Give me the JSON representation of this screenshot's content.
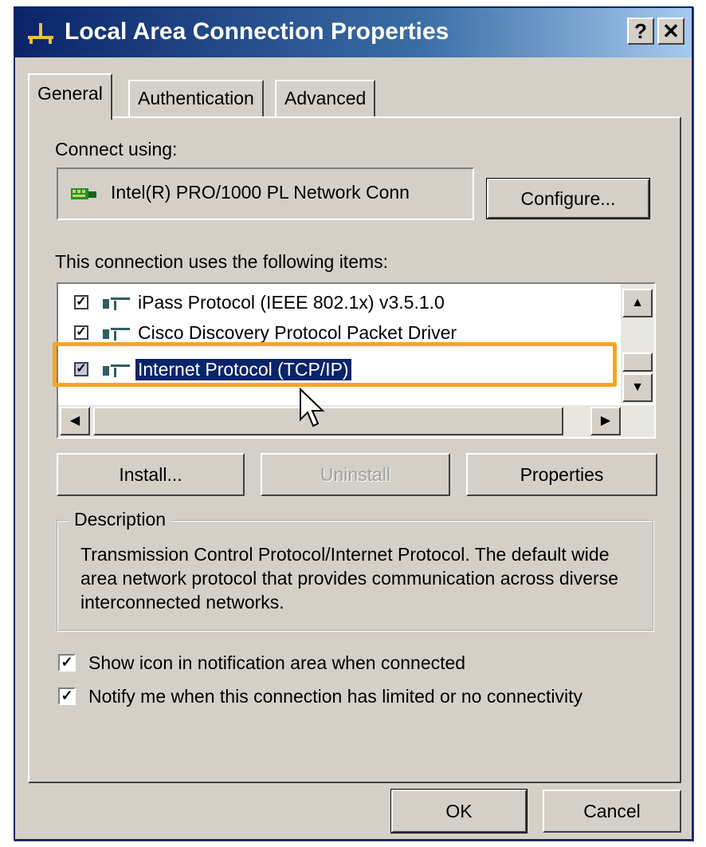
{
  "window": {
    "title": "Local Area Connection Properties",
    "help_button": "?",
    "close_button": "✕"
  },
  "tabs": [
    {
      "label": "General",
      "active": true
    },
    {
      "label": "Authentication",
      "active": false
    },
    {
      "label": "Advanced",
      "active": false
    }
  ],
  "connect": {
    "label": "Connect using:",
    "adapter": "Intel(R) PRO/1000 PL Network Conn",
    "configure_button": "Configure..."
  },
  "items": {
    "label": "This connection uses the following items:",
    "list": [
      {
        "label": "iPass Protocol (IEEE 802.1x) v3.5.1.0",
        "checked": true,
        "selected": false
      },
      {
        "label": "Cisco Discovery Protocol Packet Driver",
        "checked": true,
        "selected": false
      },
      {
        "label": "Internet Protocol (TCP/IP)",
        "checked": true,
        "selected": true
      }
    ]
  },
  "buttons": {
    "install": "Install...",
    "uninstall": "Uninstall",
    "properties": "Properties",
    "ok": "OK",
    "cancel": "Cancel"
  },
  "description": {
    "legend": "Description",
    "text": "Transmission Control Protocol/Internet Protocol. The default wide area network protocol that provides communication across diverse interconnected networks."
  },
  "options": [
    {
      "label": "Show icon in notification area when connected",
      "checked": true
    },
    {
      "label": "Notify me when this connection has limited or no connectivity",
      "checked": true
    }
  ],
  "colors": {
    "titlebar": "#0a246a",
    "highlight_box": "#f5a623",
    "selection": "#0a246a"
  }
}
